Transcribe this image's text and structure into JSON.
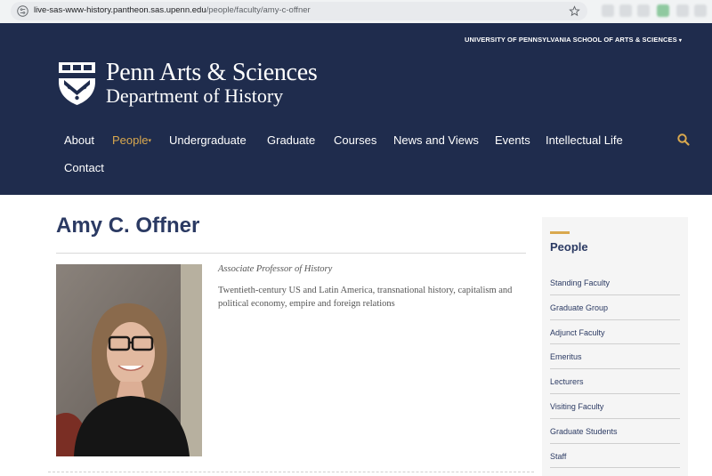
{
  "browser": {
    "url_host": "live-sas-www-history.pantheon.sas.upenn.edu",
    "url_path": "/people/faculty/amy-c-offner"
  },
  "header": {
    "school_link": "UNIVERSITY OF PENNSYLVANIA SCHOOL OF ARTS & SCIENCES",
    "logo_line1": "Penn Arts & Sciences",
    "logo_line2": "Department of History"
  },
  "nav": {
    "items": [
      {
        "label": "About"
      },
      {
        "label": "People",
        "active": true
      },
      {
        "label": "Undergraduate"
      },
      {
        "label": "Graduate"
      },
      {
        "label": "Courses"
      },
      {
        "label": "News and Views"
      },
      {
        "label": "Events"
      },
      {
        "label": "Intellectual Life"
      },
      {
        "label": "Contact"
      }
    ],
    "search_icon": "search-icon"
  },
  "profile": {
    "name": "Amy C. Offner",
    "role": "Associate Professor of History",
    "interests": "Twentieth-century US and Latin America, transnational history, capitalism and political economy, empire and foreign relations"
  },
  "sidebar": {
    "heading": "People",
    "items": [
      {
        "label": "Standing Faculty"
      },
      {
        "label": "Graduate Group"
      },
      {
        "label": "Adjunct Faculty"
      },
      {
        "label": "Emeritus"
      },
      {
        "label": "Lecturers"
      },
      {
        "label": "Visiting Faculty"
      },
      {
        "label": "Graduate Students"
      },
      {
        "label": "Staff"
      }
    ]
  },
  "colors": {
    "header_bg": "#1f2c4d",
    "accent_gold": "#d9a84e",
    "title_navy": "#2b3a63"
  }
}
